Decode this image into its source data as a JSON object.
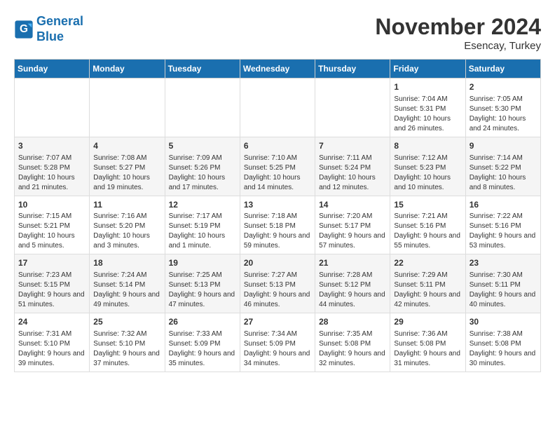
{
  "logo": {
    "line1": "General",
    "line2": "Blue"
  },
  "title": "November 2024",
  "location": "Esencay, Turkey",
  "weekdays": [
    "Sunday",
    "Monday",
    "Tuesday",
    "Wednesday",
    "Thursday",
    "Friday",
    "Saturday"
  ],
  "weeks": [
    [
      {
        "day": "",
        "info": ""
      },
      {
        "day": "",
        "info": ""
      },
      {
        "day": "",
        "info": ""
      },
      {
        "day": "",
        "info": ""
      },
      {
        "day": "",
        "info": ""
      },
      {
        "day": "1",
        "info": "Sunrise: 7:04 AM\nSunset: 5:31 PM\nDaylight: 10 hours and 26 minutes."
      },
      {
        "day": "2",
        "info": "Sunrise: 7:05 AM\nSunset: 5:30 PM\nDaylight: 10 hours and 24 minutes."
      }
    ],
    [
      {
        "day": "3",
        "info": "Sunrise: 7:07 AM\nSunset: 5:28 PM\nDaylight: 10 hours and 21 minutes."
      },
      {
        "day": "4",
        "info": "Sunrise: 7:08 AM\nSunset: 5:27 PM\nDaylight: 10 hours and 19 minutes."
      },
      {
        "day": "5",
        "info": "Sunrise: 7:09 AM\nSunset: 5:26 PM\nDaylight: 10 hours and 17 minutes."
      },
      {
        "day": "6",
        "info": "Sunrise: 7:10 AM\nSunset: 5:25 PM\nDaylight: 10 hours and 14 minutes."
      },
      {
        "day": "7",
        "info": "Sunrise: 7:11 AM\nSunset: 5:24 PM\nDaylight: 10 hours and 12 minutes."
      },
      {
        "day": "8",
        "info": "Sunrise: 7:12 AM\nSunset: 5:23 PM\nDaylight: 10 hours and 10 minutes."
      },
      {
        "day": "9",
        "info": "Sunrise: 7:14 AM\nSunset: 5:22 PM\nDaylight: 10 hours and 8 minutes."
      }
    ],
    [
      {
        "day": "10",
        "info": "Sunrise: 7:15 AM\nSunset: 5:21 PM\nDaylight: 10 hours and 5 minutes."
      },
      {
        "day": "11",
        "info": "Sunrise: 7:16 AM\nSunset: 5:20 PM\nDaylight: 10 hours and 3 minutes."
      },
      {
        "day": "12",
        "info": "Sunrise: 7:17 AM\nSunset: 5:19 PM\nDaylight: 10 hours and 1 minute."
      },
      {
        "day": "13",
        "info": "Sunrise: 7:18 AM\nSunset: 5:18 PM\nDaylight: 9 hours and 59 minutes."
      },
      {
        "day": "14",
        "info": "Sunrise: 7:20 AM\nSunset: 5:17 PM\nDaylight: 9 hours and 57 minutes."
      },
      {
        "day": "15",
        "info": "Sunrise: 7:21 AM\nSunset: 5:16 PM\nDaylight: 9 hours and 55 minutes."
      },
      {
        "day": "16",
        "info": "Sunrise: 7:22 AM\nSunset: 5:16 PM\nDaylight: 9 hours and 53 minutes."
      }
    ],
    [
      {
        "day": "17",
        "info": "Sunrise: 7:23 AM\nSunset: 5:15 PM\nDaylight: 9 hours and 51 minutes."
      },
      {
        "day": "18",
        "info": "Sunrise: 7:24 AM\nSunset: 5:14 PM\nDaylight: 9 hours and 49 minutes."
      },
      {
        "day": "19",
        "info": "Sunrise: 7:25 AM\nSunset: 5:13 PM\nDaylight: 9 hours and 47 minutes."
      },
      {
        "day": "20",
        "info": "Sunrise: 7:27 AM\nSunset: 5:13 PM\nDaylight: 9 hours and 46 minutes."
      },
      {
        "day": "21",
        "info": "Sunrise: 7:28 AM\nSunset: 5:12 PM\nDaylight: 9 hours and 44 minutes."
      },
      {
        "day": "22",
        "info": "Sunrise: 7:29 AM\nSunset: 5:11 PM\nDaylight: 9 hours and 42 minutes."
      },
      {
        "day": "23",
        "info": "Sunrise: 7:30 AM\nSunset: 5:11 PM\nDaylight: 9 hours and 40 minutes."
      }
    ],
    [
      {
        "day": "24",
        "info": "Sunrise: 7:31 AM\nSunset: 5:10 PM\nDaylight: 9 hours and 39 minutes."
      },
      {
        "day": "25",
        "info": "Sunrise: 7:32 AM\nSunset: 5:10 PM\nDaylight: 9 hours and 37 minutes."
      },
      {
        "day": "26",
        "info": "Sunrise: 7:33 AM\nSunset: 5:09 PM\nDaylight: 9 hours and 35 minutes."
      },
      {
        "day": "27",
        "info": "Sunrise: 7:34 AM\nSunset: 5:09 PM\nDaylight: 9 hours and 34 minutes."
      },
      {
        "day": "28",
        "info": "Sunrise: 7:35 AM\nSunset: 5:08 PM\nDaylight: 9 hours and 32 minutes."
      },
      {
        "day": "29",
        "info": "Sunrise: 7:36 AM\nSunset: 5:08 PM\nDaylight: 9 hours and 31 minutes."
      },
      {
        "day": "30",
        "info": "Sunrise: 7:38 AM\nSunset: 5:08 PM\nDaylight: 9 hours and 30 minutes."
      }
    ]
  ]
}
